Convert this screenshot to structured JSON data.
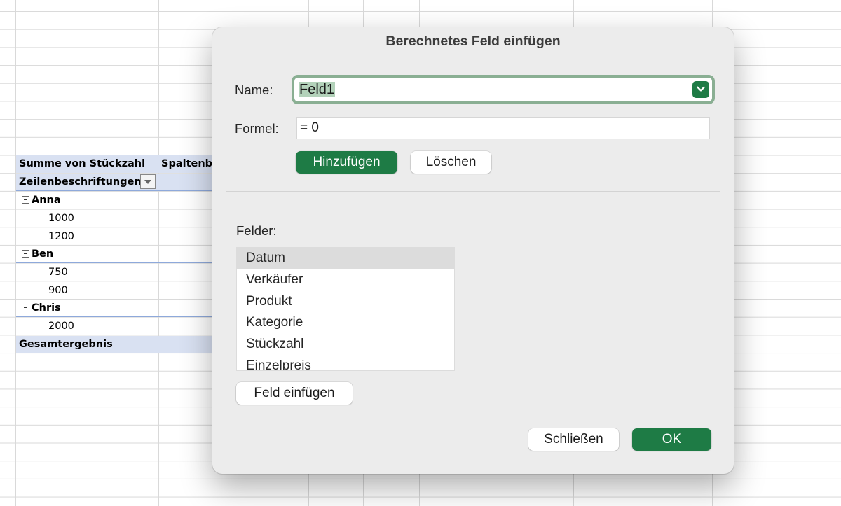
{
  "pivot": {
    "header_values": "Summe von Stückzahl",
    "header_columns": "Spaltenbeschriftungen",
    "header_rows": "Zeilenbeschriftungen",
    "groups": [
      {
        "name": "Anna",
        "items": [
          "1000",
          "1200"
        ]
      },
      {
        "name": "Ben",
        "items": [
          "750",
          "900"
        ]
      },
      {
        "name": "Chris",
        "items": [
          "2000"
        ]
      }
    ],
    "total_label": "Gesamtergebnis"
  },
  "dialog": {
    "title": "Berechnetes Feld einfügen",
    "name_label": "Name:",
    "name_value": "Feld1",
    "formula_label": "Formel:",
    "formula_value": "= 0",
    "add_button": "Hinzufügen",
    "delete_button": "Löschen",
    "fields_label": "Felder:",
    "fields": [
      "Datum",
      "Verkäufer",
      "Produkt",
      "Kategorie",
      "Stückzahl",
      "Einzelpreis"
    ],
    "selected_field": "Datum",
    "insert_field_button": "Feld einfügen",
    "close_button": "Schließen",
    "ok_button": "OK"
  },
  "colors": {
    "accent_green": "#1e7b45",
    "pivot_header_fill": "#d9e1f2"
  }
}
